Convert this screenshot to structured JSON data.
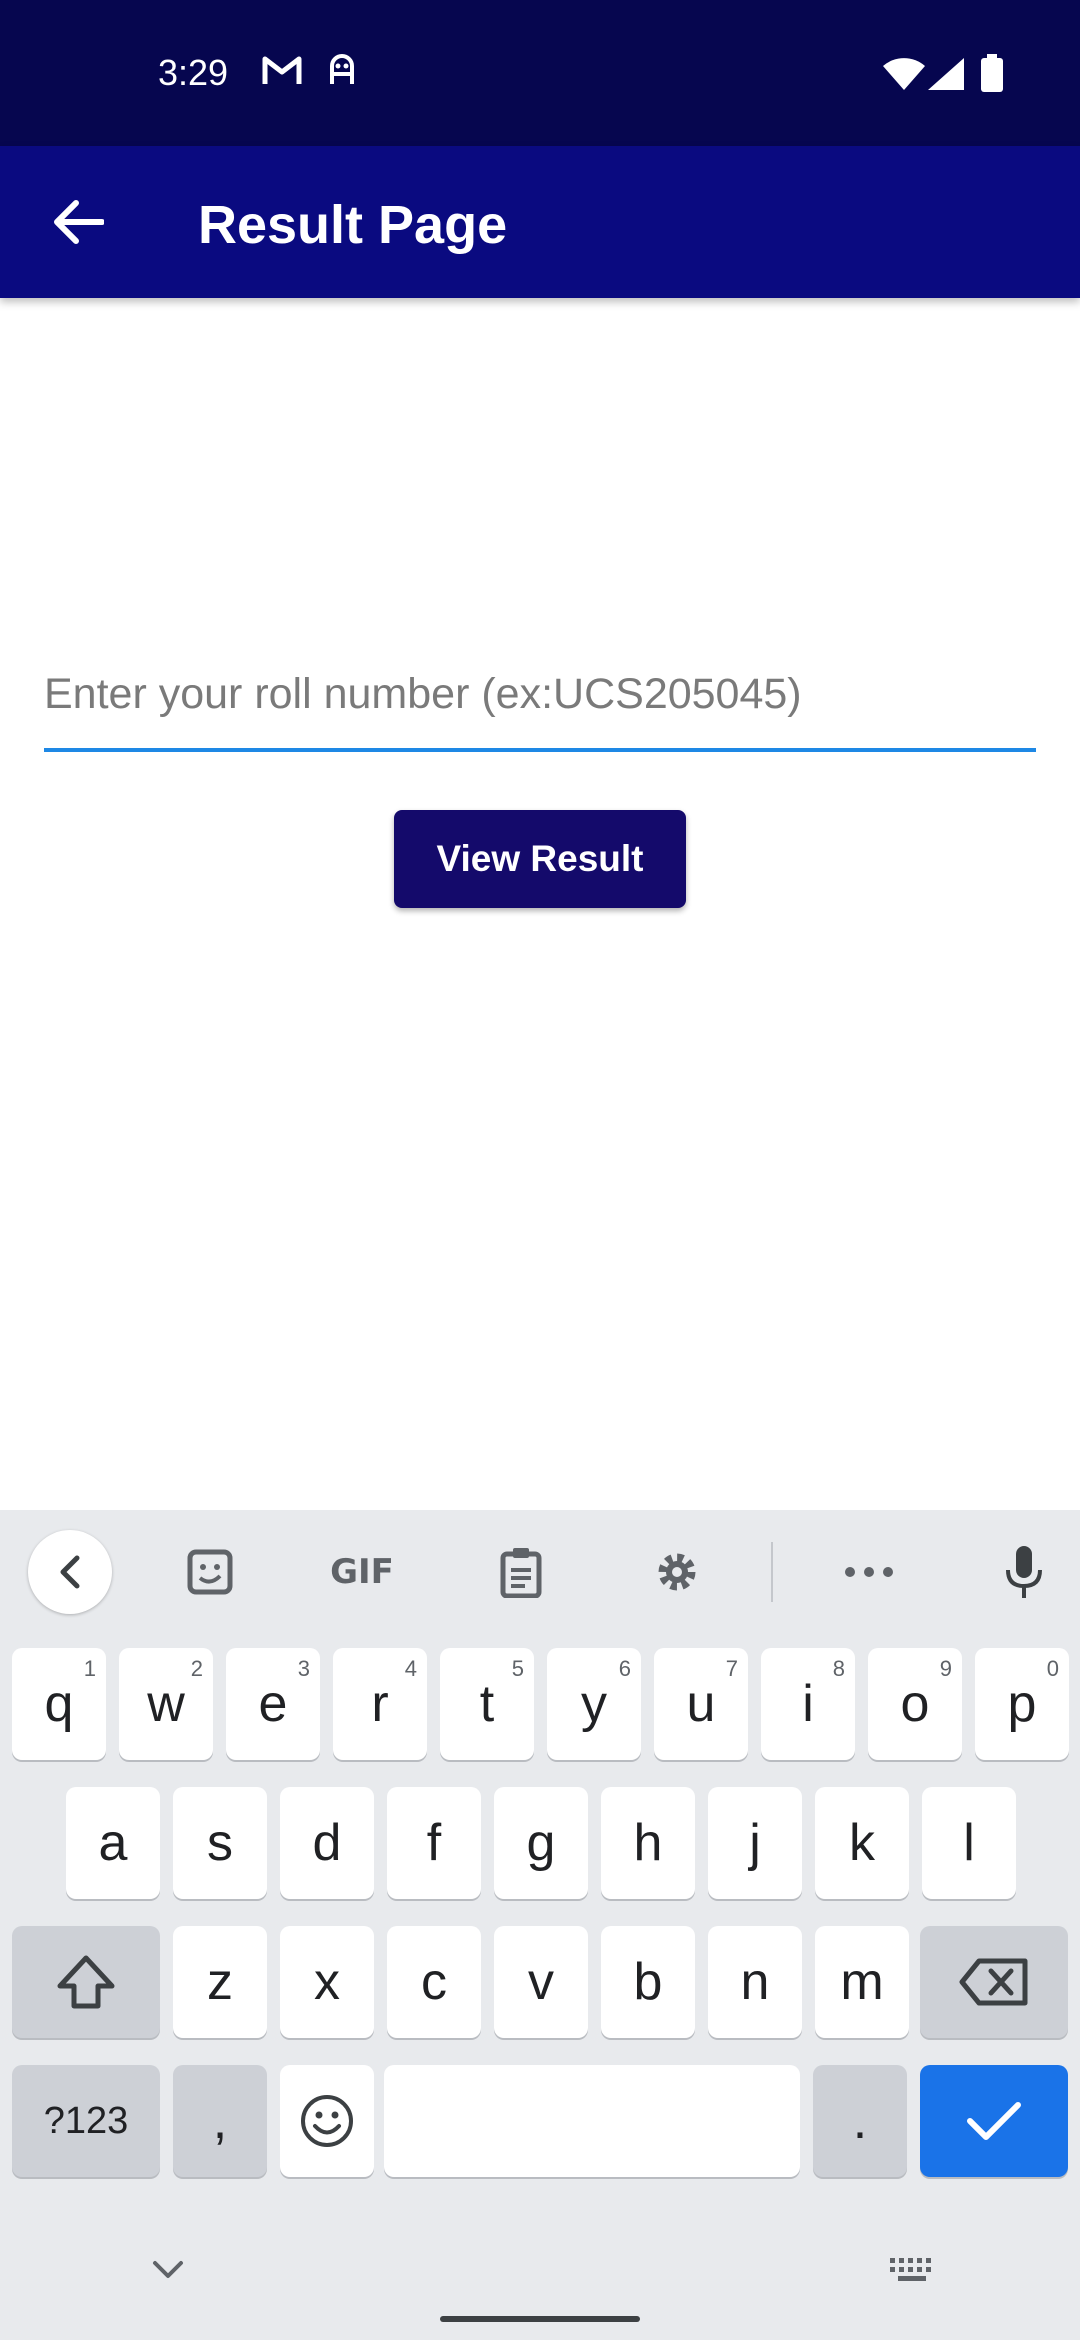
{
  "status_bar": {
    "time": "3:29",
    "icons": [
      "gmail-icon",
      "ghost-icon",
      "wifi-icon",
      "signal-icon",
      "battery-icon"
    ]
  },
  "app_bar": {
    "title": "Result Page",
    "back_icon": "arrow-left-icon"
  },
  "form": {
    "roll_input_value": "",
    "roll_input_placeholder": "Enter your roll number (ex:UCS205045)",
    "view_result_label": "View Result"
  },
  "keyboard": {
    "toolbar": {
      "collapse_icon": "chevron-left-icon",
      "sticker_icon": "sticker-icon",
      "gif_label": "GIF",
      "clipboard_icon": "clipboard-icon",
      "settings_icon": "gear-icon",
      "more_icon": "more-horizontal-icon",
      "mic_icon": "microphone-icon"
    },
    "row1": [
      {
        "key": "q",
        "hint": "1"
      },
      {
        "key": "w",
        "hint": "2"
      },
      {
        "key": "e",
        "hint": "3"
      },
      {
        "key": "r",
        "hint": "4"
      },
      {
        "key": "t",
        "hint": "5"
      },
      {
        "key": "y",
        "hint": "6"
      },
      {
        "key": "u",
        "hint": "7"
      },
      {
        "key": "i",
        "hint": "8"
      },
      {
        "key": "o",
        "hint": "9"
      },
      {
        "key": "p",
        "hint": "0"
      }
    ],
    "row2": [
      "a",
      "s",
      "d",
      "f",
      "g",
      "h",
      "j",
      "k",
      "l"
    ],
    "row3": [
      "z",
      "x",
      "c",
      "v",
      "b",
      "n",
      "m"
    ],
    "bottom": {
      "symbols_label": "?123",
      "comma_label": ",",
      "period_label": ".",
      "space_label": ""
    },
    "colors": {
      "background": "#e8eaed",
      "key": "#ffffff",
      "function_key": "#cdd0d6",
      "action_key": "#1a73e8"
    }
  },
  "colors": {
    "status_bar": "#06064f",
    "app_bar": "#0a0a80",
    "button": "#140a6b",
    "input_underline": "#1e88e5"
  }
}
